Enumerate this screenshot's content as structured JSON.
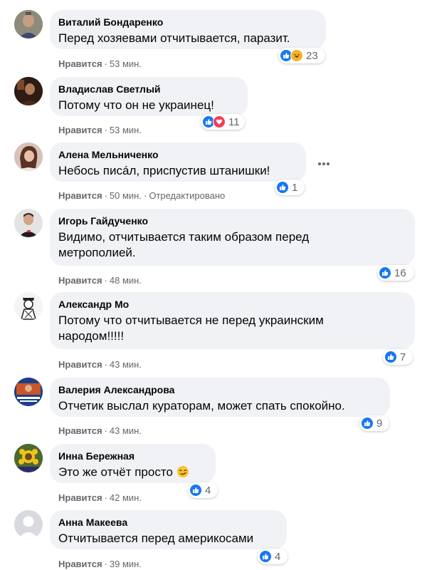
{
  "ui": {
    "like_label": "Нравится",
    "dot": "·"
  },
  "comments": [
    {
      "author": "Виталий Бондаренко",
      "text": "Перед хозяевами отчитывается, паразит.",
      "time": "53 мин.",
      "reactions": [
        "like",
        "haha"
      ],
      "count": "23"
    },
    {
      "author": "Владислав Светлый",
      "text": "Потому что он не украинец!",
      "time": "53 мин.",
      "reactions": [
        "like",
        "love"
      ],
      "count": "11"
    },
    {
      "author": "Алена Мельниченко",
      "text": "Небось писáл, приспустив штанишки!",
      "time": "50 мин.",
      "edited": "Отредактировано",
      "reactions": [
        "like"
      ],
      "count": "1"
    },
    {
      "author": "Игорь Гайдученко",
      "text": "Видимо, отчитывается таким образом перед метрополией.",
      "time": "48 мин.",
      "reactions": [
        "like"
      ],
      "count": "16"
    },
    {
      "author": "Александр Мо",
      "text": "Потому что отчитывается не перед украинским народом!!!!!",
      "time": "43 мин.",
      "reactions": [
        "like"
      ],
      "count": "7"
    },
    {
      "author": "Валерия Александрова",
      "text": "Отчетик выслал кураторам, может спать спокойно.",
      "time": "43 мин.",
      "reactions": [
        "like"
      ],
      "count": "9"
    },
    {
      "author": "Инна Бережная",
      "text": "Это же отчёт просто",
      "emoji": "smirk-emoji",
      "time": "42 мин.",
      "reactions": [
        "like"
      ],
      "count": "4"
    },
    {
      "author": "Анна Макеева",
      "text": "Отчитывается перед америкосами",
      "time": "39 мин.",
      "reactions": [
        "like"
      ],
      "count": "4"
    }
  ],
  "colors": {
    "like_blue": "#1877f2",
    "bubble_bg": "#f0f2f5",
    "meta_gray": "#65676b"
  },
  "icons": [
    "thumbs-up-icon",
    "haha-icon",
    "heart-icon",
    "more-dots-icon",
    "avatar-placeholder-icon",
    "smirk-emoji"
  ]
}
